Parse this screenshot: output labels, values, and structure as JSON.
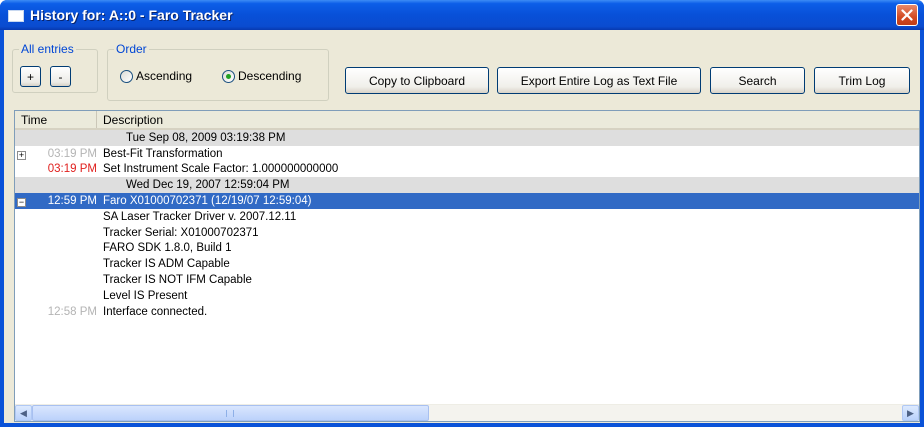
{
  "window": {
    "title": "History for: A::0 - Faro Tracker",
    "close_glyph": "✕"
  },
  "all_entries": {
    "label": "All entries",
    "expand_label": "+",
    "collapse_label": "-"
  },
  "order": {
    "label": "Order",
    "options": [
      "Ascending",
      "Descending"
    ],
    "selected": "Descending"
  },
  "toolbar": {
    "copy_label": "Copy to Clipboard",
    "export_label": "Export Entire Log as Text File",
    "search_label": "Search",
    "trim_label": "Trim Log"
  },
  "list": {
    "columns": [
      "Time",
      "Description"
    ],
    "rows": [
      {
        "type": "date",
        "text": "Tue Sep 08, 2009  03:19:38 PM"
      },
      {
        "type": "entry",
        "expander": "+",
        "time": "03:19 PM",
        "time_style": "gray",
        "desc": "Best-Fit Transformation"
      },
      {
        "type": "entry",
        "expander": "",
        "time": "03:19 PM",
        "time_style": "red",
        "desc": "Set Instrument Scale Factor: 1.000000000000"
      },
      {
        "type": "date",
        "text": "Wed Dec 19, 2007  12:59:04 PM"
      },
      {
        "type": "entry",
        "expander": "−",
        "time": "12:59 PM",
        "time_style": "selected",
        "desc": "Faro X01000702371 (12/19/07 12:59:04)"
      },
      {
        "type": "entry",
        "expander": "",
        "time": "",
        "time_style": "",
        "desc": "SA Laser Tracker Driver v. 2007.12.11"
      },
      {
        "type": "entry",
        "expander": "",
        "time": "",
        "time_style": "",
        "desc": "Tracker Serial: X01000702371"
      },
      {
        "type": "entry",
        "expander": "",
        "time": "",
        "time_style": "",
        "desc": "FARO SDK 1.8.0, Build 1"
      },
      {
        "type": "entry",
        "expander": "",
        "time": "",
        "time_style": "",
        "desc": "Tracker IS ADM Capable"
      },
      {
        "type": "entry",
        "expander": "",
        "time": "",
        "time_style": "",
        "desc": "Tracker IS NOT IFM Capable"
      },
      {
        "type": "entry",
        "expander": "",
        "time": "",
        "time_style": "",
        "desc": "Level IS Present"
      },
      {
        "type": "entry",
        "expander": "",
        "time": "12:58 PM",
        "time_style": "gray",
        "desc": "Interface connected."
      }
    ],
    "selected_row": 4
  },
  "scrollbar": {
    "left_arrow": "◀",
    "right_arrow": "▶",
    "position": 0
  },
  "colors": {
    "title_bar": "#0a52d8",
    "selection": "#316ac5",
    "date_row": "#dedede",
    "time_gray": "#b4b4b4",
    "time_red": "#e0201e",
    "group_label": "#0046d5"
  }
}
